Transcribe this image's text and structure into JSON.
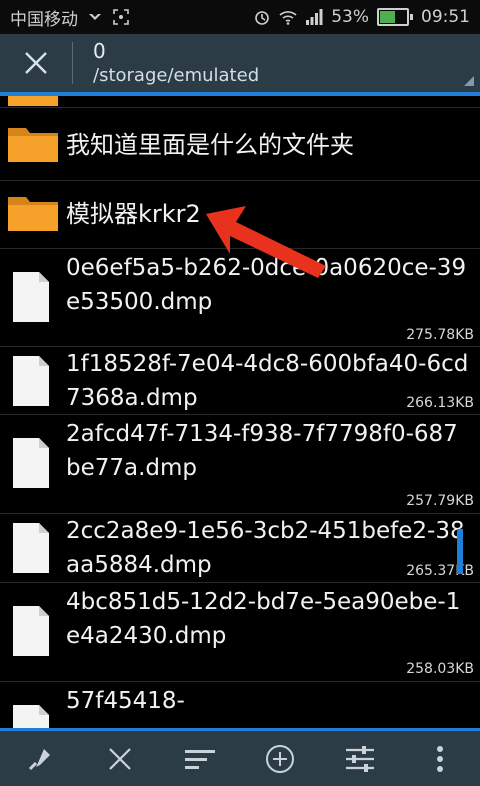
{
  "status_bar": {
    "carrier": "中国移动",
    "battery_percent": "53%",
    "time": "09:51",
    "icons": [
      "usb-icon",
      "screenshot-icon",
      "alarm-icon",
      "wifi-icon",
      "signal-icon",
      "battery-icon"
    ]
  },
  "header": {
    "selected_count": "0",
    "path": "/storage/emulated"
  },
  "folders": [
    {
      "name": "我知道里面是什么的文件夹"
    },
    {
      "name": "模拟器krkr2"
    }
  ],
  "files": [
    {
      "name": "0e6ef5a5-b262-0dce-0a0620ce-39e53500.dmp",
      "size": "275.78KB"
    },
    {
      "name": "1f18528f-7e04-4dc8-600bfa40-6cd7368a.dmp",
      "size": "266.13KB"
    },
    {
      "name": "2afcd47f-7134-f938-7f7798f0-687be77a.dmp",
      "size": "257.79KB"
    },
    {
      "name": "2cc2a8e9-1e56-3cb2-451befe2-38aa5884.dmp",
      "size": "265.37KB"
    },
    {
      "name": "4bc851d5-12d2-bd7e-5ea90ebe-1e4a2430.dmp",
      "size": "258.03KB"
    },
    {
      "name": "57f45418-",
      "size": ""
    }
  ],
  "bottom_bar": {
    "buttons": [
      "paste-icon",
      "close-icon",
      "sort-icon",
      "add-icon",
      "filter-settings-icon",
      "more-icon"
    ]
  },
  "colors": {
    "header_bg": "#2c3c46",
    "accent": "#1f7ed8",
    "folder": "#f6a12a",
    "arrow": "#e8321e"
  }
}
